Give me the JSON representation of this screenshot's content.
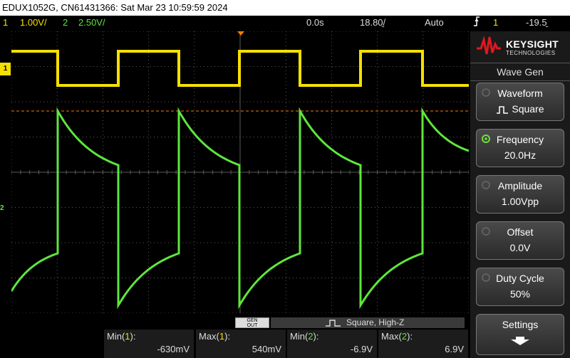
{
  "title_bar": "EDUX1052G, CN61431366: Sat Mar 23 10:59:59 2024",
  "status": {
    "ch1_num": "1",
    "ch1_scale": "1.00V/",
    "ch2_num": "2",
    "ch2_scale": "2.50V/",
    "time_pos": "0.0s",
    "time_scale": "18.80̱/",
    "trigger_mode": "Auto",
    "trigger_ch": "1",
    "trigger_level": "-19.5̱"
  },
  "markers": {
    "ch1_ground": "1",
    "ch2_ground": "2"
  },
  "colors": {
    "ch1": "#f5e000",
    "ch2": "#5ee63c",
    "trigger_line": "#ff7a00",
    "grid": "#5a5a5a"
  },
  "brand": {
    "name": "KEYSIGHT",
    "sub": "TECHNOLOGIES",
    "logo_icon": "keysight-wave-icon"
  },
  "panel": {
    "title": "Wave Gen",
    "softkeys": [
      {
        "label": "Waveform",
        "value": "Square",
        "icon": "square-wave-icon"
      },
      {
        "label": "Frequency",
        "value": "20.0Hz",
        "icon": "rotary-knob-icon"
      },
      {
        "label": "Amplitude",
        "value": "1.00Vpp",
        "icon": "rotary-knob-icon"
      },
      {
        "label": "Offset",
        "value": "0.0V",
        "icon": "rotary-knob-icon"
      },
      {
        "label": "Duty Cycle",
        "value": "50%",
        "icon": "rotary-knob-icon"
      },
      {
        "label": "Settings",
        "value": "",
        "icon": "arrow-down-icon"
      }
    ]
  },
  "gen_out": {
    "line1": "GEN",
    "line2": "OUT",
    "wave_desc": "Square, High-Z"
  },
  "measurements": [
    {
      "label": "Min(",
      "ch": "1",
      "suffix": "):",
      "value": "-630mV"
    },
    {
      "label": "Max(",
      "ch": "1",
      "suffix": "):",
      "value": "540mV"
    },
    {
      "label": "Min(",
      "ch": "2",
      "suffix": "):",
      "value": "-6.9V"
    },
    {
      "label": "Max(",
      "ch": "2",
      "suffix": "):",
      "value": "6.9V"
    }
  ]
}
